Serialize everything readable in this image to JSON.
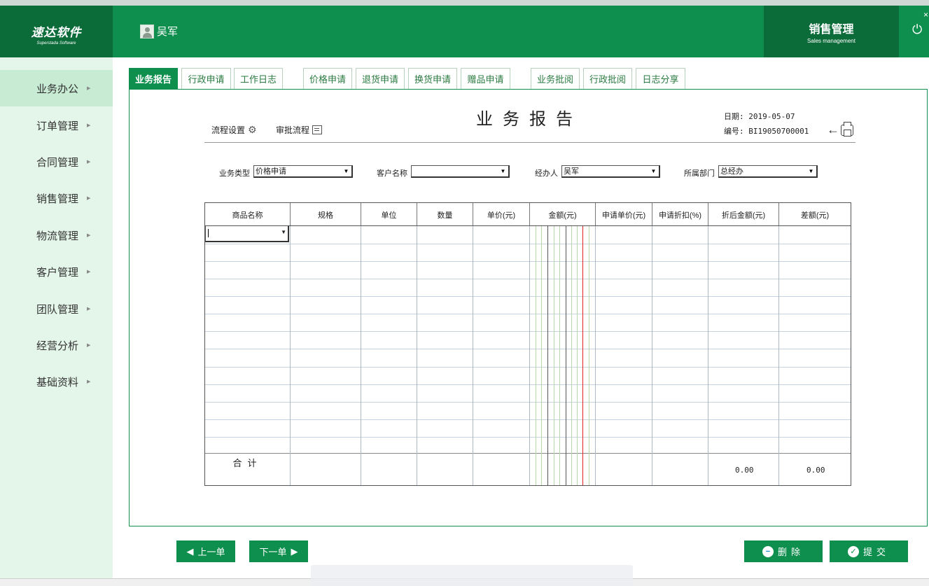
{
  "window": {
    "title_strip": ""
  },
  "brand": {
    "name": "速达软件",
    "tagline": "Superstada Software"
  },
  "user": {
    "name": "吴军"
  },
  "module": {
    "name": "销售管理",
    "subtitle": "Sales management"
  },
  "sidebar": {
    "items": [
      {
        "label": "业务办公"
      },
      {
        "label": "订单管理"
      },
      {
        "label": "合同管理"
      },
      {
        "label": "销售管理"
      },
      {
        "label": "物流管理"
      },
      {
        "label": "客户管理"
      },
      {
        "label": "团队管理"
      },
      {
        "label": "经营分析"
      },
      {
        "label": "基础资料"
      }
    ]
  },
  "tabs": [
    {
      "label": "业务报告"
    },
    {
      "label": "行政申请"
    },
    {
      "label": "工作日志"
    },
    {
      "label": "价格申请"
    },
    {
      "label": "退货申请"
    },
    {
      "label": "换货申请"
    },
    {
      "label": "赠品申请"
    },
    {
      "label": "业务批阅"
    },
    {
      "label": "行政批阅"
    },
    {
      "label": "日志分享"
    }
  ],
  "toolbar": {
    "flow_settings": "流程设置",
    "approval_flow": "审批流程"
  },
  "report": {
    "title": "业务报告",
    "date": "日期: 2019-05-07",
    "number": "编号: BI19050700001"
  },
  "form": {
    "business_type_label": "业务类型",
    "business_type_value": "价格申请",
    "customer_label": "客户名称",
    "customer_value": "",
    "handler_label": "经办人",
    "handler_value": "吴军",
    "dept_label": "所属部门",
    "dept_value": "总经办"
  },
  "table": {
    "columns": [
      "商品名称",
      "规格",
      "单位",
      "数量",
      "单价(元)",
      "金额(元)",
      "申请单价(元)",
      "申请折扣(%)",
      "折后金额(元)",
      "差额(元)"
    ],
    "total_label": "合计",
    "total_discounted": "0.00",
    "total_diff": "0.00"
  },
  "buttons": {
    "prev": "上一单",
    "next": "下一单",
    "delete": "删除",
    "submit": "提交"
  }
}
